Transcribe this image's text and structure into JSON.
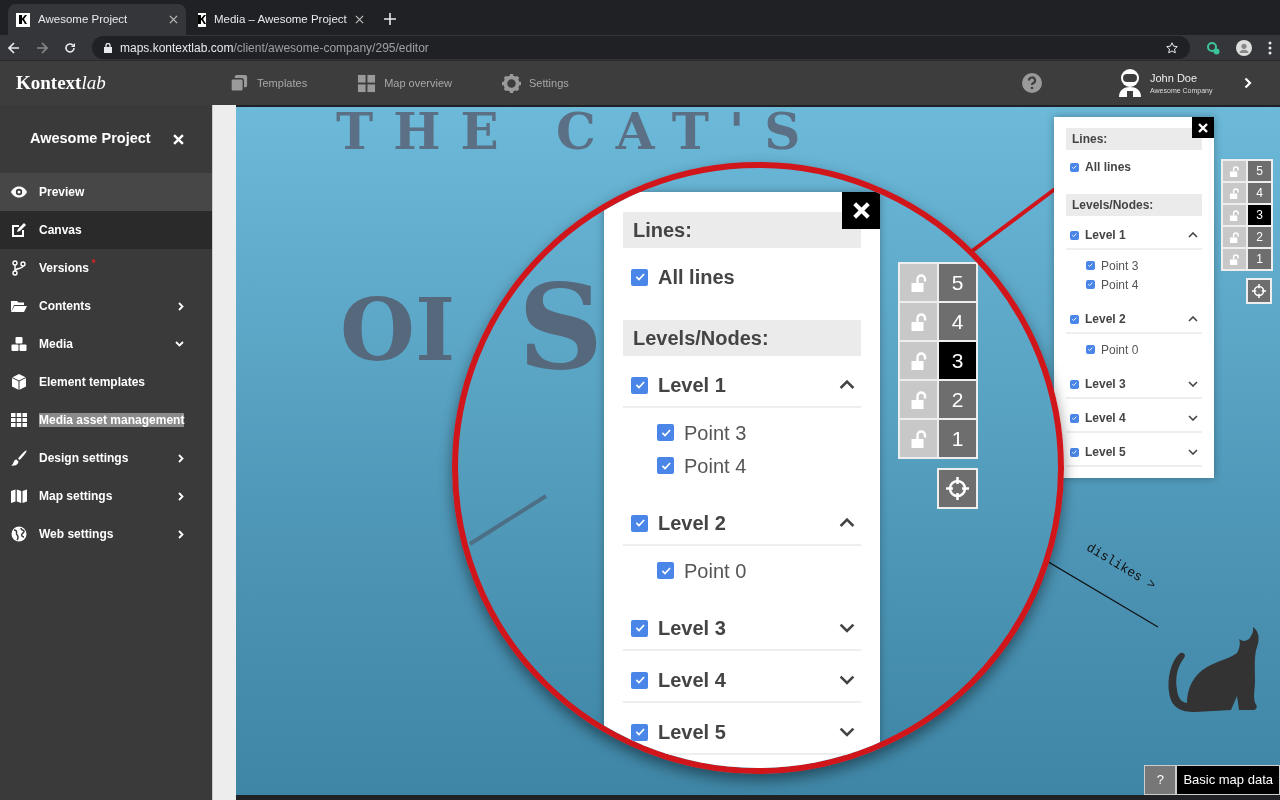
{
  "browser": {
    "tabs": [
      {
        "title": "Awesome Project",
        "selected": true
      },
      {
        "title": "Media – Awesome Project",
        "selected": false
      }
    ],
    "url": {
      "host": "maps.kontextlab.com",
      "path": "/client/awesome-company/295/editor"
    }
  },
  "header": {
    "logo": {
      "text": "Kontext",
      "italic": "lab"
    },
    "nav": [
      {
        "label": "Templates"
      },
      {
        "label": "Map overview"
      },
      {
        "label": "Settings"
      }
    ],
    "user": {
      "name": "John Doe",
      "company": "Awesome Company"
    }
  },
  "sidebar": {
    "title": "Awesome Project",
    "items": [
      {
        "label": "Preview",
        "selected": false,
        "hovered": true
      },
      {
        "label": "Canvas",
        "selected": true,
        "hovered": false
      },
      {
        "label": "Versions",
        "selected": false,
        "hovered": false,
        "marker": "*"
      },
      {
        "label": "Contents",
        "selected": false,
        "hovered": false,
        "expanded": false
      },
      {
        "label": "Media",
        "selected": false,
        "hovered": false,
        "expanded": true
      },
      {
        "label": "Element templates",
        "selected": false,
        "hovered": false
      },
      {
        "label": "Media asset management",
        "selected": false,
        "hovered": false,
        "text_highlighted": true
      },
      {
        "label": "Design settings",
        "selected": false,
        "hovered": false,
        "expanded": false
      },
      {
        "label": "Map settings",
        "selected": false,
        "hovered": false,
        "expanded": false
      },
      {
        "label": "Web settings",
        "selected": false,
        "hovered": false,
        "expanded": false
      }
    ]
  },
  "canvas": {
    "title": "THE CAT'S",
    "subtitle_left": "OI",
    "subtitle_zoomed": "S",
    "edge_label": "dislikes >"
  },
  "magnifier": {
    "layer_panel": {
      "lines_heading": "Lines:",
      "all_lines": {
        "label": "All lines",
        "checked": true
      },
      "levels_heading": "Levels/Nodes:",
      "levels": [
        {
          "label": "Level 1",
          "checked": true,
          "expanded": true,
          "points": [
            {
              "label": "Point 3",
              "checked": true
            },
            {
              "label": "Point 4",
              "checked": true
            }
          ]
        },
        {
          "label": "Level 2",
          "checked": true,
          "expanded": true,
          "points": [
            {
              "label": "Point 0",
              "checked": true
            }
          ]
        },
        {
          "label": "Level 3",
          "checked": true,
          "expanded": false
        },
        {
          "label": "Level 4",
          "checked": true,
          "expanded": false
        },
        {
          "label": "Level 5",
          "checked": true,
          "expanded": false
        }
      ]
    },
    "layer_stack": [
      {
        "number": "5",
        "selected": false
      },
      {
        "number": "4",
        "selected": false
      },
      {
        "number": "3",
        "selected": true
      },
      {
        "number": "2",
        "selected": false
      },
      {
        "number": "1",
        "selected": false
      }
    ]
  },
  "layer_panel": {
    "lines_heading": "Lines:",
    "all_lines": {
      "label": "All lines",
      "checked": true
    },
    "levels_heading": "Levels/Nodes:",
    "levels": [
      {
        "label": "Level 1",
        "checked": true,
        "expanded": true,
        "points": [
          {
            "label": "Point 3",
            "checked": true
          },
          {
            "label": "Point 4",
            "checked": true
          }
        ]
      },
      {
        "label": "Level 2",
        "checked": true,
        "expanded": true,
        "points": [
          {
            "label": "Point 0",
            "checked": true
          }
        ]
      },
      {
        "label": "Level 3",
        "checked": true,
        "expanded": false
      },
      {
        "label": "Level 4",
        "checked": true,
        "expanded": false
      },
      {
        "label": "Level 5",
        "checked": true,
        "expanded": false
      }
    ]
  },
  "layer_stack": [
    {
      "number": "5",
      "selected": false
    },
    {
      "number": "4",
      "selected": false
    },
    {
      "number": "3",
      "selected": true
    },
    {
      "number": "2",
      "selected": false
    },
    {
      "number": "1",
      "selected": false
    }
  ],
  "footer": {
    "help": "?",
    "label": "Basic map data"
  }
}
